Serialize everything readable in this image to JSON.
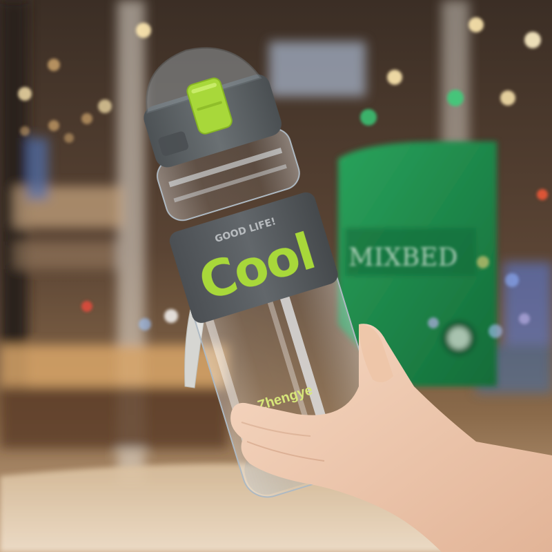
{
  "photo": {
    "subject": "clear water bottle held in hand",
    "sleeve": {
      "tagline": "GOOD LIFE!",
      "headline": "Cool"
    },
    "brand": "Zhengye",
    "store_sign": "MIXBED"
  },
  "colors": {
    "accent_green": "#a8d83a",
    "sleeve_gray": "#555a5e",
    "lid_gray": "#5f6467",
    "shop_green": "#1f8a4c",
    "warm_bokeh": "#ffe9b0"
  }
}
